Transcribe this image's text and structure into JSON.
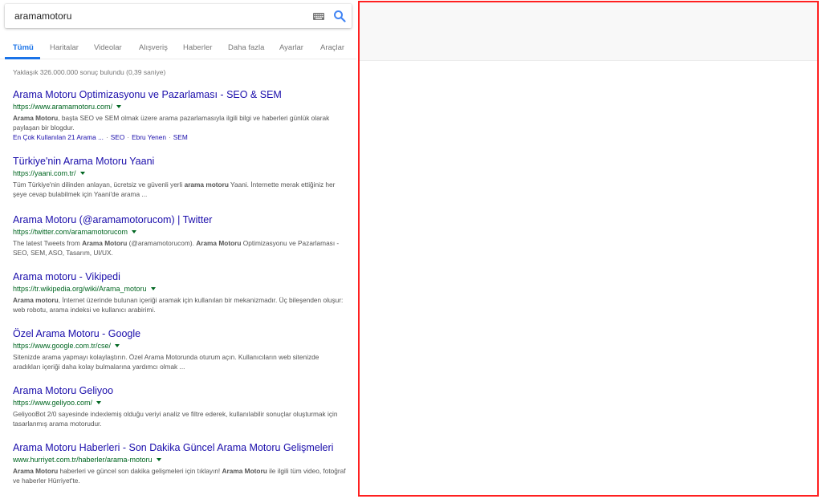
{
  "search": {
    "query": "aramamotoru"
  },
  "tabs": [
    {
      "label": "Tümü"
    },
    {
      "label": "Haritalar"
    },
    {
      "label": "Videolar"
    },
    {
      "label": "Alışveriş"
    },
    {
      "label": "Haberler"
    },
    {
      "label": "Daha fazla"
    },
    {
      "label": "Ayarlar"
    },
    {
      "label": "Araçlar"
    }
  ],
  "stats": "Yaklaşık 326.000.000 sonuç bulundu (0,39 saniye)",
  "results": [
    {
      "title": "Arama Motoru Optimizasyonu ve Pazarlaması - SEO & SEM",
      "url": "https://www.aramamotoru.com/",
      "snippet_html": "<b>Arama Motoru</b>, başta SEO ve SEM olmak üzere arama pazarlamasıyla ilgili bilgi ve haberleri günlük olarak paylaşan bir blogdur.",
      "sitelinks": [
        "En Çok Kullanılan 21 Arama ...",
        "SEO",
        "Ebru Yenen",
        "SEM"
      ]
    },
    {
      "title": "Türkiye'nin Arama Motoru Yaani",
      "url": "https://yaani.com.tr/",
      "snippet_html": "Tüm Türkiye'nin dilinden anlayan, ücretsiz ve güvenli yerli <b>arama motoru</b> Yaani. İnternette merak ettiğiniz her şeye cevap bulabilmek için Yaani'de arama ..."
    },
    {
      "title": "Arama Motoru (@aramamotorucom) | Twitter",
      "url": "https://twitter.com/aramamotorucom",
      "snippet_html": "The latest Tweets from <b>Arama Motoru</b> (@aramamotorucom). <b>Arama Motoru</b> Optimizasyonu ve Pazarlaması - SEO, SEM, ASO, Tasarım, UI/UX."
    },
    {
      "title": "Arama motoru - Vikipedi",
      "url": "https://tr.wikipedia.org/wiki/Arama_motoru",
      "snippet_html": "<b>Arama motoru</b>, İnternet üzerinde bulunan içeriği aramak için kullanılan bir mekanizmadır. Üç bileşenden oluşur: web robotu, arama indeksi ve kullanıcı arabirimi."
    },
    {
      "title": "Özel Arama Motoru - Google",
      "url": "https://www.google.com.tr/cse/",
      "snippet_html": "Sitenizde arama yapmayı kolaylaştırın. Özel Arama Motorunda oturum açın. Kullanıcıların web sitenizde aradıkları içeriği daha kolay bulmalarına yardımcı olmak ..."
    },
    {
      "title": "Arama Motoru Geliyoo",
      "url": "https://www.geliyoo.com/",
      "snippet_html": "GeliyooBot 2/0 sayesinde indexlemiş olduğu veriyi analiz ve filtre ederek, kullanılabilir sonuçlar oluşturmak için tasarlanmış arama motorudur."
    },
    {
      "title": "Arama Motoru Haberleri - Son Dakika Güncel Arama Motoru Gelişmeleri",
      "url": "www.hurriyet.com.tr/haberler/arama-motoru",
      "snippet_html": "<b>Arama Motoru</b> haberleri ve güncel son dakika gelişmeleri için tıklayın! <b>Arama Motoru</b> ile ilgili tüm video, fotoğraf ve haberler Hürriyet'te."
    }
  ],
  "colors": {
    "link": "#1a0dab",
    "url": "#006621",
    "snippet": "#545454",
    "accent": "#1a73e8",
    "highlight_border": "#ff2020"
  },
  "icons": [
    "keyboard-icon",
    "search-icon",
    "dropdown-caret-icon"
  ]
}
